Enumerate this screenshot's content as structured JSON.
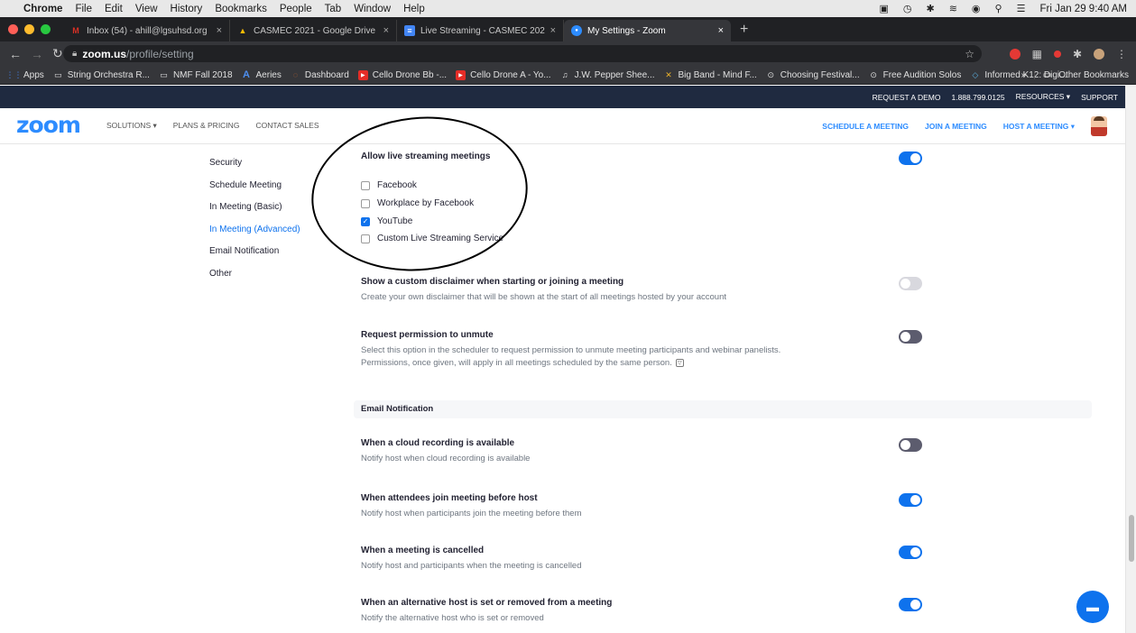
{
  "menubar": {
    "apple": "",
    "items": [
      "Chrome",
      "File",
      "Edit",
      "View",
      "History",
      "Bookmarks",
      "People",
      "Tab",
      "Window",
      "Help"
    ],
    "clock": "Fri Jan 29  9:40 AM"
  },
  "tabs": [
    {
      "title": "Inbox (54) - ahill@lgsuhsd.org",
      "fav_color": "#d93025",
      "fav": "M"
    },
    {
      "title": "CASMEC 2021 - Google Drive",
      "fav_color": "#fbbc04",
      "fav": "▲"
    },
    {
      "title": "Live Streaming - CASMEC 202",
      "fav_color": "#4285f4",
      "fav": "≡"
    },
    {
      "title": "My Settings - Zoom",
      "fav_color": "#2d8cff",
      "fav": "●",
      "active": true
    }
  ],
  "address": {
    "host": "zoom.us",
    "path": "/profile/setting"
  },
  "bookmarks": [
    {
      "label": "Apps",
      "color": "#4285f4",
      "icon": "⋮⋮"
    },
    {
      "label": "String Orchestra R...",
      "color": "",
      "icon": "▭"
    },
    {
      "label": "NMF Fall 2018",
      "color": "",
      "icon": "▭"
    },
    {
      "label": "Aeries",
      "color": "#4d8ff0",
      "icon": "A"
    },
    {
      "label": "Dashboard",
      "color": "#e8712b",
      "icon": "◌"
    },
    {
      "label": "Cello Drone Bb -...",
      "color": "#e52d27",
      "icon": "▶"
    },
    {
      "label": "Cello Drone A - Yo...",
      "color": "#e52d27",
      "icon": "▶"
    },
    {
      "label": "J.W. Pepper Shee...",
      "color": "#888",
      "icon": "♫"
    },
    {
      "label": "Big Band - Mind F...",
      "color": "#e8b02b",
      "icon": "✕"
    },
    {
      "label": "Choosing Festival...",
      "color": "#ddd",
      "icon": "⊙"
    },
    {
      "label": "Free Audition Solos",
      "color": "#ddd",
      "icon": "⊙"
    },
    {
      "label": "Informed K12: Digi...",
      "color": "#5ab0e0",
      "icon": "◇"
    }
  ],
  "other_bookmarks": "Other Bookmarks",
  "util": {
    "request_demo": "REQUEST A DEMO",
    "phone": "1.888.799.0125",
    "resources": "RESOURCES ▾",
    "support": "SUPPORT"
  },
  "zoom_header": {
    "logo": "zoom",
    "nav": [
      "SOLUTIONS ▾",
      "PLANS & PRICING",
      "CONTACT SALES"
    ],
    "schedule": "SCHEDULE A MEETING",
    "join": "JOIN A MEETING",
    "host": "HOST A MEETING ▾"
  },
  "side_nav": [
    "Security",
    "Schedule Meeting",
    "In Meeting (Basic)",
    "In Meeting (Advanced)",
    "Email Notification",
    "Other"
  ],
  "live_streaming": {
    "title": "Allow live streaming meetings",
    "enabled": true,
    "options": [
      {
        "label": "Facebook",
        "checked": false
      },
      {
        "label": "Workplace by Facebook",
        "checked": false
      },
      {
        "label": "YouTube",
        "checked": true
      },
      {
        "label": "Custom Live Streaming Service",
        "checked": false
      }
    ]
  },
  "disclaimer": {
    "title": "Show a custom disclaimer when starting or joining a meeting",
    "desc": "Create your own disclaimer that will be shown at the start of all meetings hosted by your account",
    "state": "disabled"
  },
  "unmute": {
    "title": "Request permission to unmute",
    "desc1": "Select this option in the scheduler to request permission to unmute meeting participants and webinar panelists.",
    "desc2": "Permissions, once given, will apply in all meetings scheduled by the same person.",
    "state": "off"
  },
  "email_section": "Email Notification",
  "email_settings": [
    {
      "title": "When a cloud recording is available",
      "desc": "Notify host when cloud recording is available",
      "state": "off"
    },
    {
      "title": "When attendees join meeting before host",
      "desc": "Notify host when participants join the meeting before them",
      "state": "on"
    },
    {
      "title": "When a meeting is cancelled",
      "desc": "Notify host and participants when the meeting is cancelled",
      "state": "on"
    },
    {
      "title": "When an alternative host is set or removed from a meeting",
      "desc": "Notify the alternative host who is set or removed",
      "state": "on"
    }
  ]
}
